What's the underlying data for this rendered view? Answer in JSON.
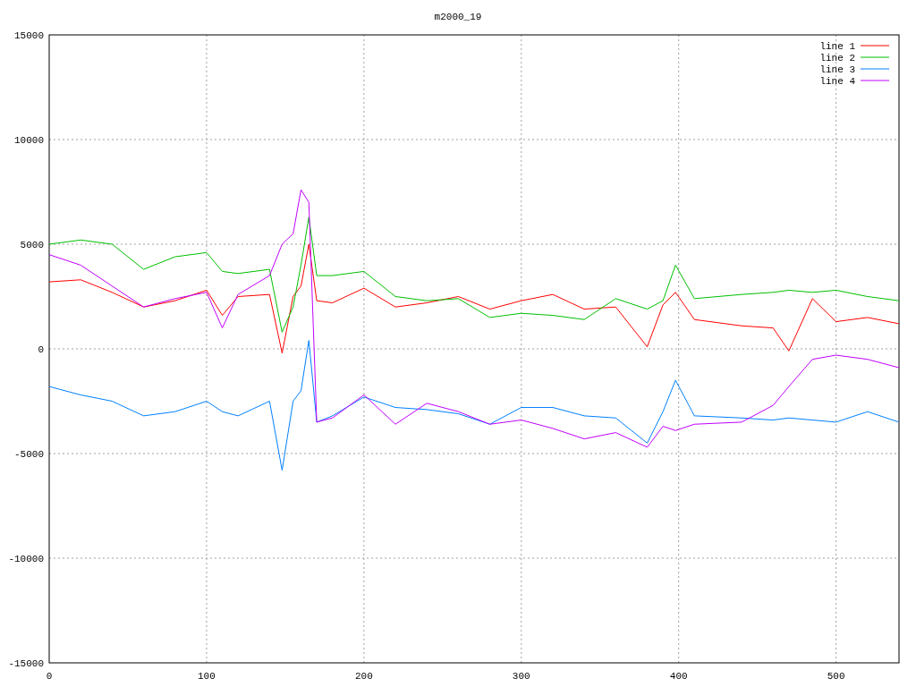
{
  "plot": {
    "chart_data": {
      "type": "line",
      "title": "m2000_19",
      "x": [
        0,
        20,
        40,
        60,
        80,
        100,
        110,
        120,
        140,
        148,
        155,
        160,
        165,
        170,
        180,
        200,
        220,
        240,
        260,
        280,
        300,
        320,
        340,
        360,
        380,
        390,
        398,
        410,
        440,
        460,
        470,
        485,
        500,
        520,
        540
      ],
      "series": [
        {
          "name": "line 1",
          "color": "#ff0000",
          "values": [
            3200,
            3300,
            2700,
            2000,
            2300,
            2800,
            1600,
            2500,
            2600,
            -200,
            2500,
            3000,
            5000,
            2300,
            2200,
            2900,
            2000,
            2200,
            2500,
            1900,
            2300,
            2600,
            1900,
            2000,
            100,
            2100,
            2700,
            1400,
            1100,
            1000,
            -100,
            2400,
            1300,
            1500,
            1200
          ]
        },
        {
          "name": "line 2",
          "color": "#00c000",
          "values": [
            5000,
            5200,
            5000,
            3800,
            4400,
            4600,
            3700,
            3600,
            3800,
            800,
            2000,
            4000,
            6300,
            3500,
            3500,
            3700,
            2500,
            2300,
            2400,
            1500,
            1700,
            1600,
            1400,
            2400,
            1900,
            2300,
            4000,
            2400,
            2600,
            2700,
            2800,
            2700,
            2800,
            2500,
            2300
          ]
        },
        {
          "name": "line 3",
          "color": "#0080ff",
          "values": [
            -1800,
            -2200,
            -2500,
            -3200,
            -3000,
            -2500,
            -3000,
            -3200,
            -2500,
            -5800,
            -2500,
            -2000,
            400,
            -3500,
            -3200,
            -2300,
            -2800,
            -2900,
            -3100,
            -3600,
            -2800,
            -2800,
            -3200,
            -3300,
            -4500,
            -3000,
            -1500,
            -3200,
            -3300,
            -3400,
            -3300,
            -3400,
            -3500,
            -3000,
            -3500
          ]
        },
        {
          "name": "line 4",
          "color": "#c000ff",
          "values": [
            4500,
            4000,
            3000,
            2000,
            2400,
            2700,
            1000,
            2600,
            3500,
            5000,
            5500,
            7600,
            7000,
            -3500,
            -3300,
            -2200,
            -3600,
            -2600,
            -3000,
            -3600,
            -3400,
            -3800,
            -4300,
            -4000,
            -4700,
            -3700,
            -3900,
            -3600,
            -3500,
            -2700,
            -1800,
            -500,
            -300,
            -500,
            -900
          ]
        }
      ],
      "xlim": [
        0,
        540
      ],
      "ylim": [
        -15000,
        15000
      ],
      "xticks": [
        0,
        100,
        200,
        300,
        400,
        500
      ],
      "yticks": [
        -15000,
        -10000,
        -5000,
        0,
        5000,
        10000,
        15000
      ],
      "grid": true,
      "legend": true
    }
  }
}
